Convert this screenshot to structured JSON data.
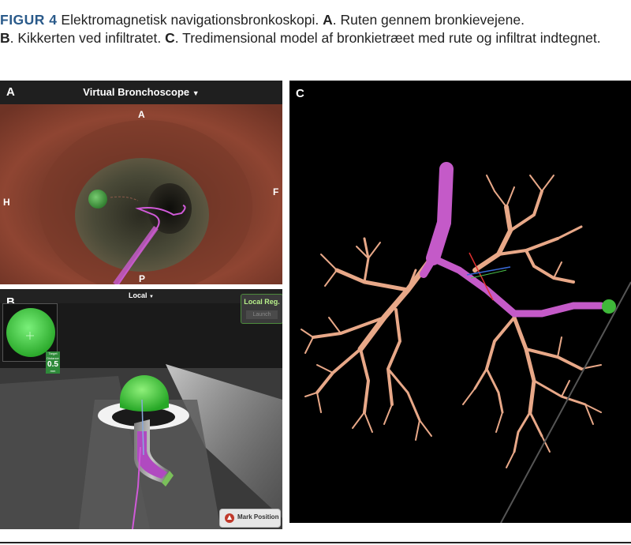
{
  "caption": {
    "figure_label": "FIGUR 4",
    "seg1": " Elektromagnetisk navigationsbronkoskopi. ",
    "a": "A",
    "seg2": ". Ruten gennem bronkievejene.",
    "b": "B",
    "seg3": ". Kikkerten ved infiltratet. ",
    "c": "C",
    "seg4": ". Tredimensional model af bronkietræet med rute og infiltrat indtegnet."
  },
  "panelA": {
    "label": "A",
    "title": "Virtual Bronchoscope",
    "dropdown_icon": "caret-down-icon",
    "orient_top": "A",
    "orient_left": "H",
    "orient_right": "F",
    "orient_bottom": "P"
  },
  "panelB": {
    "label": "B",
    "title": "Local",
    "local_reg_label": "Local Reg.",
    "launch_label": "Launch",
    "target_label": "Target",
    "distance_label": "Distance",
    "distance_value": "0.5",
    "distance_unit": "mm",
    "mark_position_label": "Mark Position"
  },
  "panelC": {
    "label": "C"
  },
  "colors": {
    "caption_accent": "#2a5a8a",
    "airway_wall": "#8a3f2c",
    "route_magenta": "#c45ac8",
    "bronchial_tree": "#e8a888",
    "target_green": "#4fd14a"
  }
}
